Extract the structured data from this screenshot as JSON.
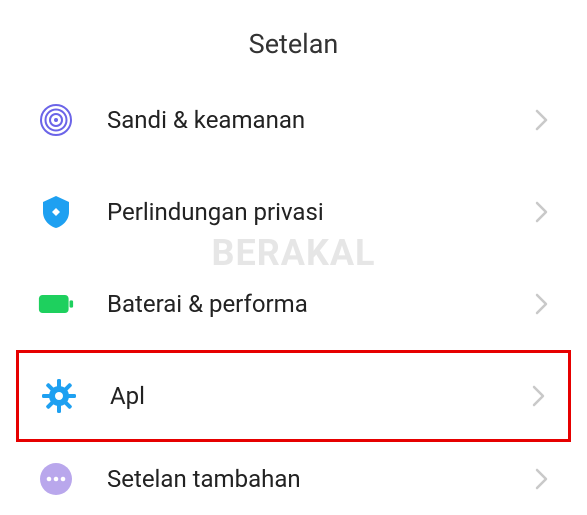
{
  "header": {
    "title": "Setelan"
  },
  "items": [
    {
      "label": "Sandi & keamanan",
      "icon": "fingerprint-icon",
      "highlighted": false
    },
    {
      "label": "Perlindungan privasi",
      "icon": "shield-icon",
      "highlighted": false
    },
    {
      "label": "Baterai & performa",
      "icon": "battery-icon",
      "highlighted": false
    },
    {
      "label": "Apl",
      "icon": "apps-cog-icon",
      "highlighted": true
    },
    {
      "label": "Setelan tambahan",
      "icon": "more-icon",
      "highlighted": false
    }
  ],
  "watermark": "BERAKAL"
}
